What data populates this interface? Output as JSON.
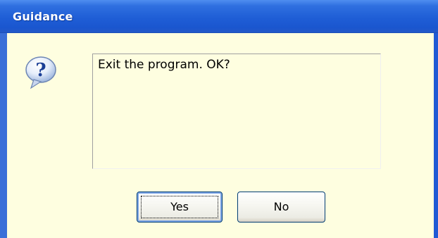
{
  "dialog": {
    "title": "Guidance",
    "message": "Exit the program. OK?",
    "icon": "question-icon",
    "buttons": {
      "yes_label": "Yes",
      "no_label": "No"
    }
  },
  "colors": {
    "titlebar": "#1f5ed6",
    "client_background": "#fefee0",
    "button_border": "#003c74"
  }
}
